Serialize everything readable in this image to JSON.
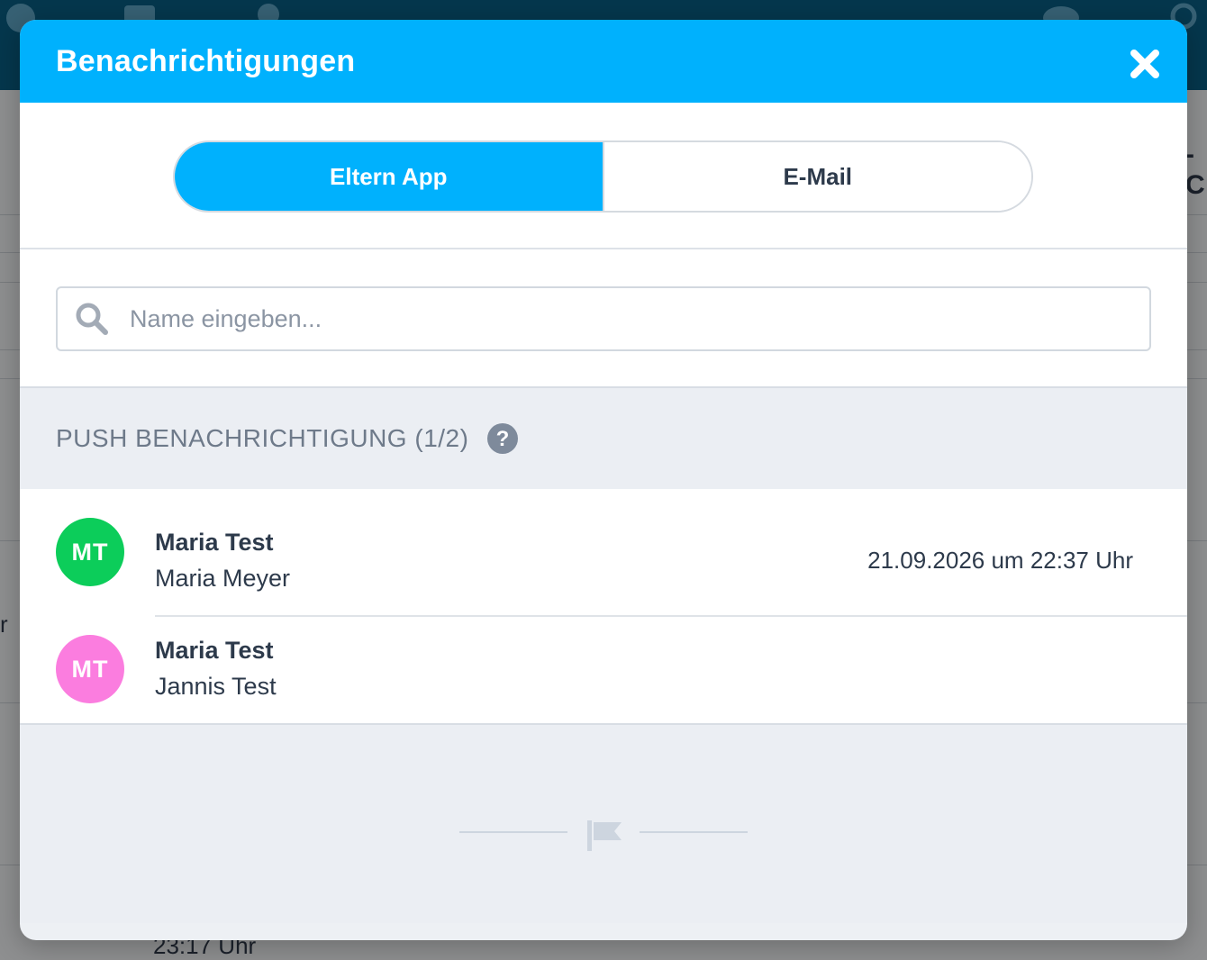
{
  "modal": {
    "title": "Benachrichtigungen"
  },
  "tabs": {
    "items": [
      {
        "label": "Eltern App",
        "active": true
      },
      {
        "label": "E-Mail",
        "active": false
      }
    ]
  },
  "search": {
    "placeholder": "Name eingeben...",
    "value": ""
  },
  "section": {
    "title": "PUSH BENACHRICHTIGUNG (1/2)"
  },
  "notifications": [
    {
      "initials": "MT",
      "avatar_color": "#0ccd5a",
      "name": "Maria Test",
      "subname": "Maria Meyer",
      "timestamp": "21.09.2026 um 22:37 Uhr"
    },
    {
      "initials": "MT",
      "avatar_color": "#fb7ddf",
      "name": "Maria Test",
      "subname": "Jannis Test",
      "timestamp": ""
    }
  ],
  "background": {
    "peek_text_right": "-C",
    "peek_text_left": "r",
    "peek_text_bottom": "23:17 Uhr"
  },
  "colors": {
    "accent": "#00b1fd",
    "header_bg": "#00b1fd",
    "text_dark": "#2d3a4b",
    "muted": "#6e7a8a"
  }
}
